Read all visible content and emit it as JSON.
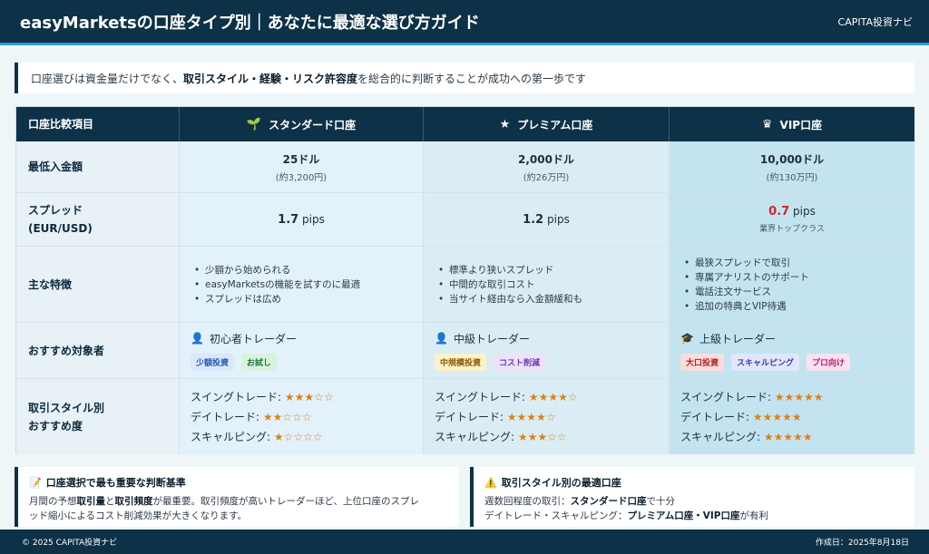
{
  "header": {
    "title": "easyMarketsの口座タイプ別｜あなたに最適な選び方ガイド",
    "brand": "CAPITA投資ナビ"
  },
  "intro": {
    "before": "口座選びは資金量だけでなく、",
    "bold": "取引スタイル・経験・リスク許容度",
    "after": "を総合的に判断することが成功への第一歩です"
  },
  "table": {
    "corner": "口座比較項目",
    "columns": [
      {
        "label": "スタンダード口座",
        "icon": "seedling-icon",
        "glyph": "🌱"
      },
      {
        "label": "プレミアム口座",
        "icon": "star-icon",
        "glyph": "★"
      },
      {
        "label": "VIP口座",
        "icon": "crown-icon",
        "glyph": "♛"
      }
    ],
    "rows": {
      "deposit": {
        "label": "最低入金額",
        "values": [
          {
            "main": "25ドル",
            "sub": "(約3,200円)"
          },
          {
            "main": "2,000ドル",
            "sub": "(約26万円)"
          },
          {
            "main": "10,000ドル",
            "sub": "(約130万円)"
          }
        ]
      },
      "spread": {
        "label_line1": "スプレッド",
        "label_line2": "(EUR/USD)",
        "unit": "pips",
        "values": [
          "1.7",
          "1.2",
          "0.7"
        ],
        "vip_note": "業界トップクラス",
        "highlight_color": "#d0262a"
      },
      "features": {
        "label": "主な特徴",
        "values": [
          [
            "少額から始められる",
            "easyMarketsの機能を試すのに最適",
            "スプレッドは広め"
          ],
          [
            "標準より狭いスプレッド",
            "中間的な取引コスト",
            "当サイト経由なら入金額緩和も"
          ],
          [
            "最狭スプレッドで取引",
            "専属アナリストのサポート",
            "電話注文サービス",
            "追加の特典とVIP待遇"
          ]
        ]
      },
      "target": {
        "label": "おすすめ対象者",
        "values": [
          {
            "who": "初心者トレーダー",
            "icon": "user-icon",
            "glyph": "👤",
            "tags": [
              {
                "text": "少額投資",
                "bg": "#dbe8fb",
                "fg": "#2358b0"
              },
              {
                "text": "お試し",
                "bg": "#d7f3dc",
                "fg": "#217a35"
              }
            ]
          },
          {
            "who": "中級トレーダー",
            "icon": "user-tie-icon",
            "glyph": "👤",
            "tags": [
              {
                "text": "中規模投資",
                "bg": "#fdf1c9",
                "fg": "#8a5a00"
              },
              {
                "text": "コスト削減",
                "bg": "#ece2fa",
                "fg": "#6a3bb0"
              }
            ]
          },
          {
            "who": "上級トレーダー",
            "icon": "graduate-icon",
            "glyph": "🎓",
            "tags": [
              {
                "text": "大口投資",
                "bg": "#fbdcdc",
                "fg": "#b02323"
              },
              {
                "text": "スキャルピング",
                "bg": "#e3e6fb",
                "fg": "#3342a8"
              },
              {
                "text": "プロ向け",
                "bg": "#fbe0ee",
                "fg": "#b0236a"
              }
            ]
          }
        ]
      },
      "style": {
        "label_line1": "取引スタイル別",
        "label_line2": "おすすめ度",
        "styles": [
          "スイングトレード:",
          "デイトレード:",
          "スキャルピング:"
        ],
        "ratings": [
          [
            3,
            2,
            1
          ],
          [
            4,
            4,
            3
          ],
          [
            5,
            5,
            5
          ]
        ],
        "max": 5
      }
    }
  },
  "boxes": [
    {
      "icon": "memo-icon",
      "glyph": "📝",
      "title": "口座選択で最も重要な判断基準",
      "line1_a": "月間の予想",
      "line1_b": "取引量",
      "line1_c": "と",
      "line1_d": "取引頻度",
      "line1_e": "が最重要。取引頻度が高いトレーダーほど、上位口座のスプレ",
      "line2": "ッド縮小によるコスト削減効果が大きくなります。"
    },
    {
      "icon": "warning-icon",
      "glyph": "⚠️",
      "title": "取引スタイル別の最適口座",
      "line1_a": "週数回程度の取引：",
      "line1_b": "スタンダード口座",
      "line1_c": "で十分",
      "line2_a": "デイトレード・スキャルピング：",
      "line2_b": "プレミアム口座・VIP口座",
      "line2_c": "が有利"
    }
  ],
  "footer": {
    "copyright": "© 2025 CAPITA投資ナビ",
    "date": "作成日：2025年8月18日"
  }
}
